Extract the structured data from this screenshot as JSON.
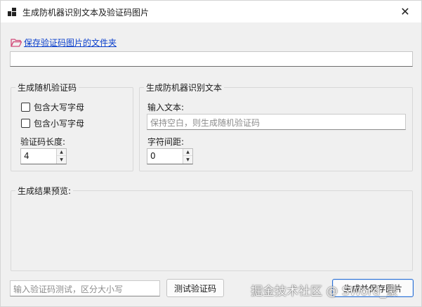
{
  "window": {
    "title": "生成防机器识别文本及验证码图片",
    "close_glyph": "✕",
    "app_icon": "app-grid-icon",
    "folder_icon": "folder-open-icon"
  },
  "save_folder_link": "保存验证码图片的文件夹",
  "save_path_value": "",
  "random_group": {
    "title": "生成随机验证码",
    "uppercase_label": "包含大写字母",
    "lowercase_label": "包含小写字母",
    "length_label": "验证码长度:",
    "length_value": "4"
  },
  "anti_group": {
    "title": "生成防机器识别文本",
    "input_label": "输入文本:",
    "input_placeholder": "保持空白，则生成随机验证码",
    "spacing_label": "字符间距:",
    "spacing_value": "0"
  },
  "preview_group": {
    "title": "生成结果预览:"
  },
  "bottom": {
    "test_placeholder": "输入验证码测试，区分大小写",
    "test_button": "测试验证码",
    "generate_button": "生成并保存图片"
  },
  "watermark": "掘金技术社区 @ SWord_豪",
  "colors": {
    "link": "#0a3fcc",
    "primary_border": "#2a6fd3",
    "folder": "#d14b7a"
  }
}
